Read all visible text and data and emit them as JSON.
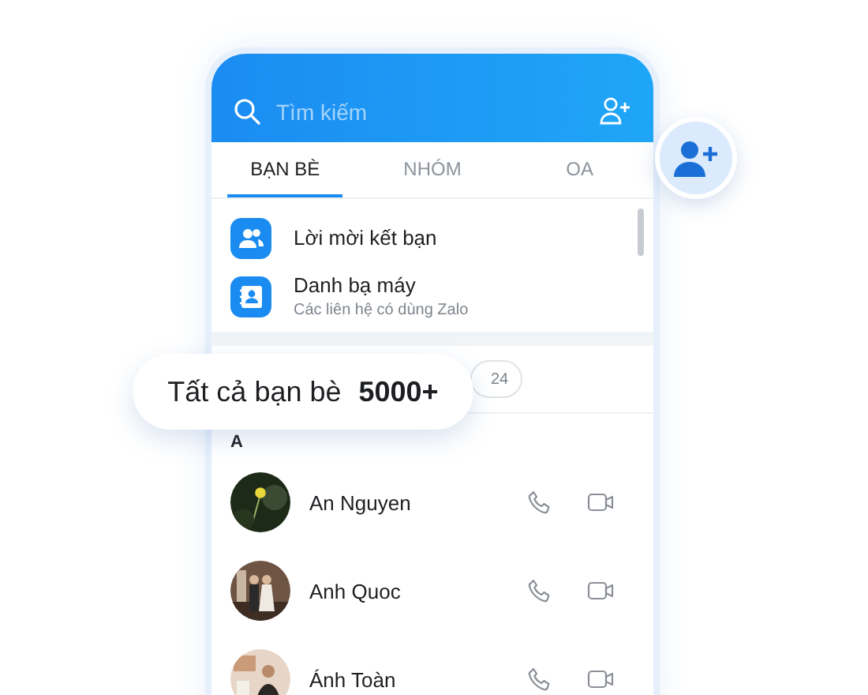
{
  "search": {
    "placeholder": "Tìm kiếm"
  },
  "tabs": [
    {
      "label": "BẠN BÈ",
      "selected": true
    },
    {
      "label": "NHÓM",
      "selected": false
    },
    {
      "label": "OA",
      "selected": false
    }
  ],
  "shortcuts": [
    {
      "kind": "requests",
      "title": "Lời mời kết bạn"
    },
    {
      "kind": "contacts",
      "title": "Danh bạ máy",
      "subtitle": "Các liên hệ có dùng Zalo"
    }
  ],
  "filter_chip": {
    "count": "24"
  },
  "section": "A",
  "contacts": [
    {
      "name": "An Nguyen"
    },
    {
      "name": "Anh Quoc"
    },
    {
      "name": "Ánh Toàn"
    }
  ],
  "callout": {
    "label": "Tất cả bạn bè",
    "count": "5000+"
  }
}
